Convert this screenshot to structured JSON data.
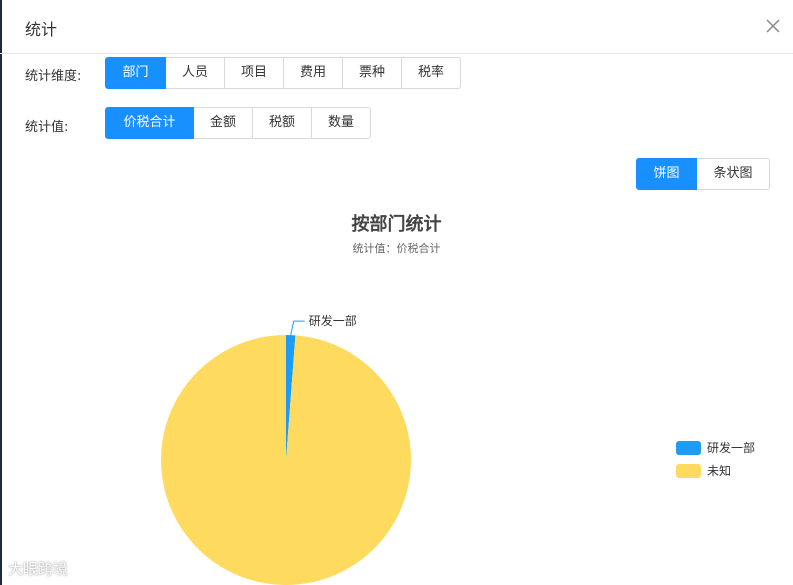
{
  "dialog": {
    "title": "统计",
    "close_icon": "close-icon"
  },
  "dimension": {
    "label": "统计维度:",
    "options": [
      "部门",
      "人员",
      "项目",
      "费用",
      "票种",
      "税率"
    ],
    "selected": "部门"
  },
  "value": {
    "label": "统计值:",
    "options": [
      "价税合计",
      "金额",
      "税额",
      "数量"
    ],
    "selected": "价税合计"
  },
  "chart_type": {
    "options": [
      "饼图",
      "条状图"
    ],
    "selected": "饼图"
  },
  "chart_data": {
    "type": "pie",
    "title": "按部门统计",
    "subtitle": "统计值：价税合计",
    "slices": [
      {
        "label": "研发一部",
        "value": 1.2,
        "color": "#1e9bf2"
      },
      {
        "label": "未知",
        "value": 98.8,
        "color": "#fedb5f"
      }
    ],
    "legend": [
      "研发一部",
      "未知"
    ],
    "legend_position": "right"
  },
  "watermark": "大眼跨境",
  "colors": {
    "accent": "#1890ff"
  }
}
